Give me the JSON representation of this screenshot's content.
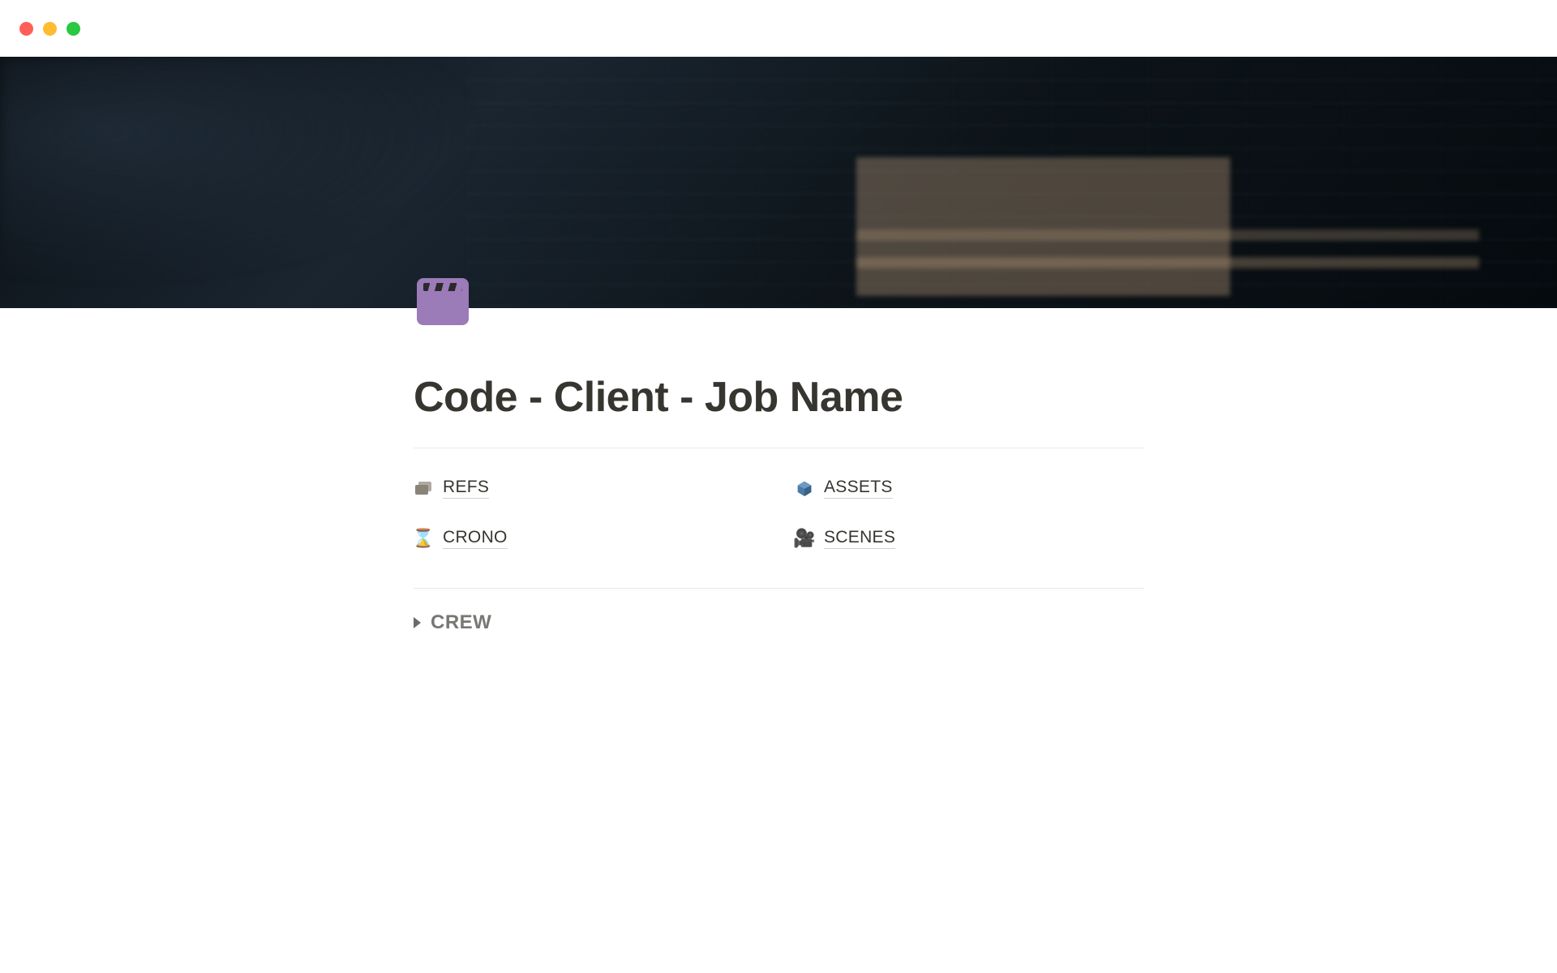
{
  "page": {
    "title": "Code - Client - Job Name"
  },
  "links": {
    "refs": {
      "label": "REFS",
      "icon": "cards-icon"
    },
    "assets": {
      "label": "ASSETS",
      "icon": "cube-icon"
    },
    "crono": {
      "label": "CRONO",
      "icon": "hourglass-icon"
    },
    "scenes": {
      "label": "SCENES",
      "icon": "movie-camera-icon"
    }
  },
  "toggle": {
    "crew": {
      "label": "CREW"
    }
  },
  "icon": {
    "page": "clapperboard"
  }
}
